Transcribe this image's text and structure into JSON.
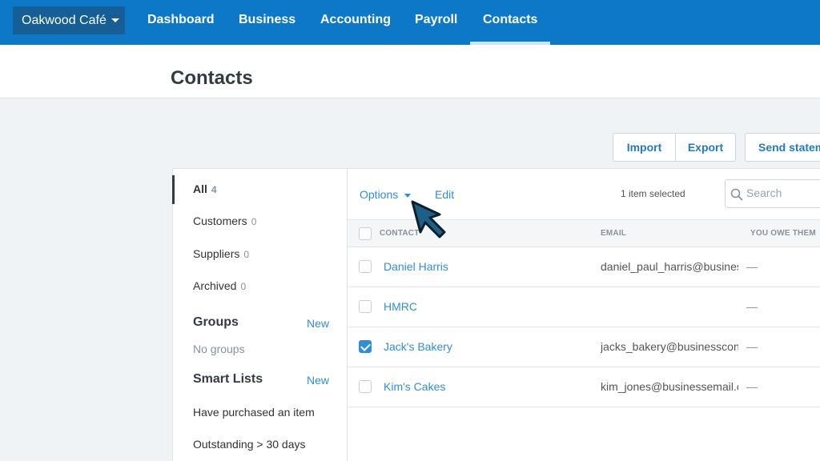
{
  "nav": {
    "org": "Oakwood Café",
    "items": [
      "Dashboard",
      "Business",
      "Accounting",
      "Payroll",
      "Contacts"
    ],
    "active": "Contacts"
  },
  "page": {
    "title": "Contacts"
  },
  "actions": {
    "import": "Import",
    "export": "Export",
    "send_statements": "Send statem"
  },
  "sidebar": {
    "items": [
      {
        "label": "All",
        "count": "4"
      },
      {
        "label": "Customers",
        "count": "0"
      },
      {
        "label": "Suppliers",
        "count": "0"
      },
      {
        "label": "Archived",
        "count": "0"
      }
    ],
    "groups": {
      "heading": "Groups",
      "new": "New",
      "empty": "No groups"
    },
    "smart_lists": {
      "heading": "Smart Lists",
      "new": "New",
      "items": [
        "Have purchased an item",
        "Outstanding > 30 days"
      ]
    }
  },
  "toolbar": {
    "options": "Options",
    "edit": "Edit",
    "selection": "1 item selected",
    "search_placeholder": "Search"
  },
  "table": {
    "columns": [
      "CONTACT",
      "EMAIL",
      "YOU OWE THEM"
    ],
    "rows": [
      {
        "name": "Daniel Harris",
        "email": "daniel_paul_harris@busines",
        "owe": "—",
        "checked": false
      },
      {
        "name": "HMRC",
        "email": "",
        "owe": "—",
        "checked": false
      },
      {
        "name": "Jack's Bakery",
        "email": "jacks_bakery@businesscont",
        "owe": "—",
        "checked": true
      },
      {
        "name": "Kim's Cakes",
        "email": "kim_jones@businessemail.c",
        "owe": "—",
        "checked": false
      }
    ]
  },
  "colors": {
    "nav_bg": "#0d78c8",
    "accent": "#2f8ed8",
    "org_bg": "#155e96"
  },
  "icons": {
    "search": "search-icon",
    "org_caret": "chevron-down-icon",
    "cursor": "cursor-arrow-icon"
  }
}
